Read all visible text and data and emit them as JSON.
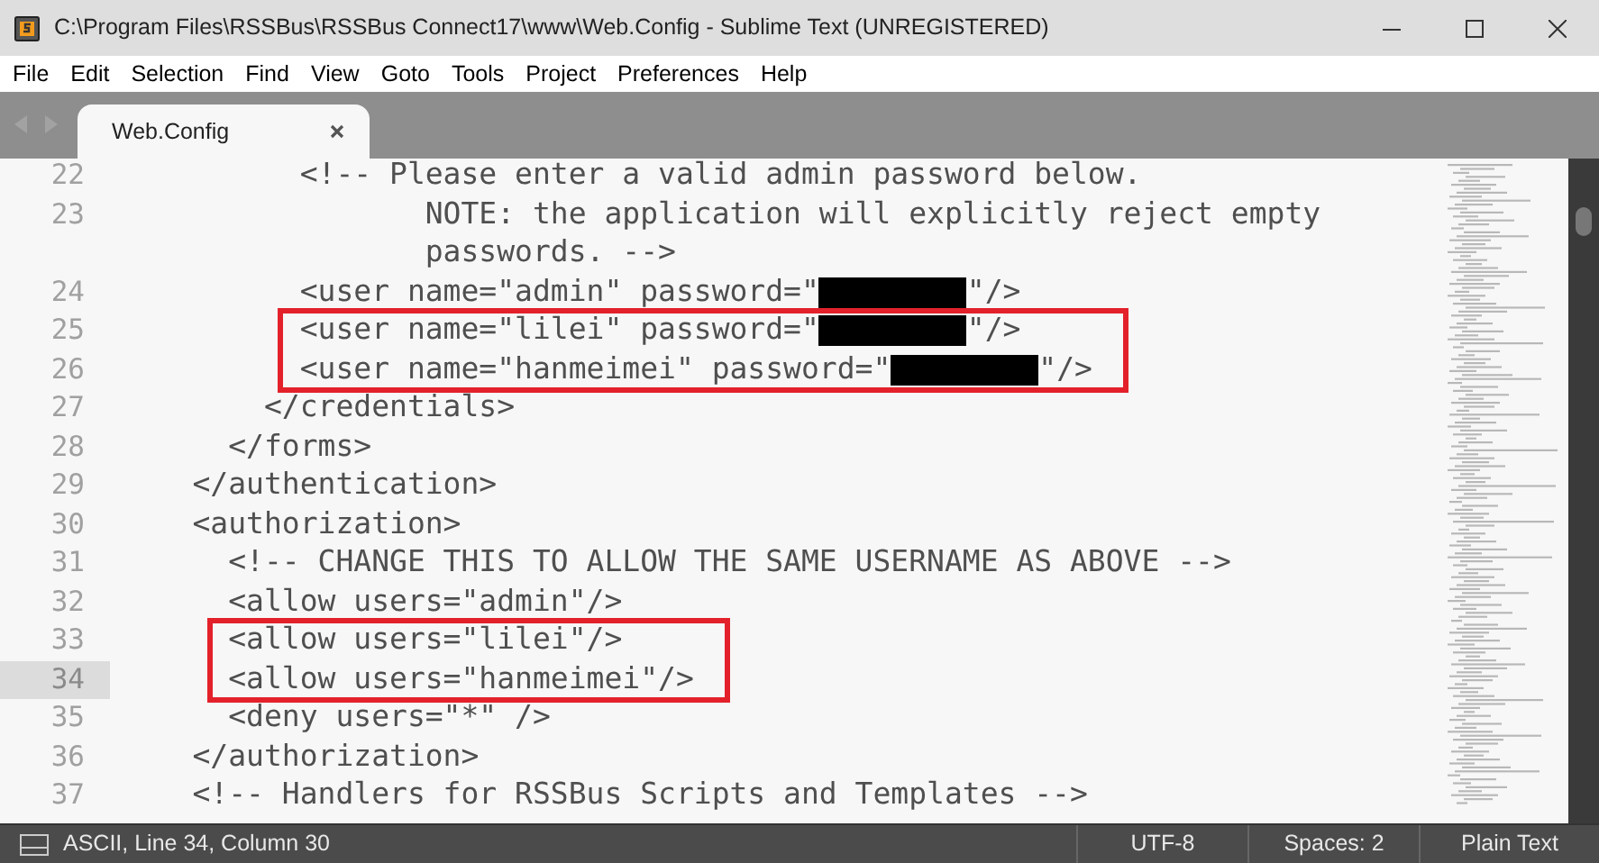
{
  "window": {
    "title": "C:\\Program Files\\RSSBus\\RSSBus Connect17\\www\\Web.Config - Sublime Text (UNREGISTERED)"
  },
  "menu": [
    "File",
    "Edit",
    "Selection",
    "Find",
    "View",
    "Goto",
    "Tools",
    "Project",
    "Preferences",
    "Help"
  ],
  "tabs": [
    {
      "label": "Web.Config",
      "selected": true
    }
  ],
  "lines": [
    {
      "number": "22",
      "current": false,
      "boxed": false,
      "rows": [
        [
          {
            "kind": "text",
            "text": "          <!-- Please enter a valid admin password below."
          }
        ]
      ]
    },
    {
      "number": "23",
      "current": false,
      "boxed": false,
      "rows": [
        [
          {
            "kind": "text",
            "text": "                 NOTE: the application will explicitly reject empty"
          }
        ],
        [
          {
            "kind": "text",
            "text": "                 passwords. -->"
          }
        ]
      ]
    },
    {
      "number": "24",
      "current": false,
      "boxed": false,
      "rows": [
        [
          {
            "kind": "text",
            "text": "          <user name=\"admin\" password=\""
          },
          {
            "kind": "redacted"
          },
          {
            "kind": "text",
            "text": "\"/>"
          }
        ]
      ]
    },
    {
      "number": "25",
      "current": false,
      "boxed": true,
      "rows": [
        [
          {
            "kind": "text",
            "text": "          <user name=\"lilei\" password=\""
          },
          {
            "kind": "redacted"
          },
          {
            "kind": "text",
            "text": "\"/>"
          }
        ]
      ]
    },
    {
      "number": "26",
      "current": false,
      "boxed": true,
      "rows": [
        [
          {
            "kind": "text",
            "text": "          <user name=\"hanmeimei\" password=\""
          },
          {
            "kind": "redacted"
          },
          {
            "kind": "text",
            "text": "\"/>"
          }
        ]
      ]
    },
    {
      "number": "27",
      "current": false,
      "boxed": false,
      "rows": [
        [
          {
            "kind": "text",
            "text": "        </credentials>"
          }
        ]
      ]
    },
    {
      "number": "28",
      "current": false,
      "boxed": false,
      "rows": [
        [
          {
            "kind": "text",
            "text": "      </forms>"
          }
        ]
      ]
    },
    {
      "number": "29",
      "current": false,
      "boxed": false,
      "rows": [
        [
          {
            "kind": "text",
            "text": "    </authentication>"
          }
        ]
      ]
    },
    {
      "number": "30",
      "current": false,
      "boxed": false,
      "rows": [
        [
          {
            "kind": "text",
            "text": "    <authorization>"
          }
        ]
      ]
    },
    {
      "number": "31",
      "current": false,
      "boxed": false,
      "rows": [
        [
          {
            "kind": "text",
            "text": "      <!-- CHANGE THIS TO ALLOW THE SAME USERNAME AS ABOVE -->"
          }
        ]
      ]
    },
    {
      "number": "32",
      "current": false,
      "boxed": false,
      "rows": [
        [
          {
            "kind": "text",
            "text": "      <allow users=\"admin\"/>"
          }
        ]
      ]
    },
    {
      "number": "33",
      "current": false,
      "boxed": true,
      "rows": [
        [
          {
            "kind": "text",
            "text": "      <allow users=\"lilei\"/>"
          }
        ]
      ]
    },
    {
      "number": "34",
      "current": true,
      "boxed": true,
      "rows": [
        [
          {
            "kind": "text",
            "text": "      <allow users=\"hanmeimei\"/>"
          }
        ]
      ]
    },
    {
      "number": "35",
      "current": false,
      "boxed": false,
      "rows": [
        [
          {
            "kind": "text",
            "text": "      <deny users=\"*\" />"
          }
        ]
      ]
    },
    {
      "number": "36",
      "current": false,
      "boxed": false,
      "rows": [
        [
          {
            "kind": "text",
            "text": "    </authorization>"
          }
        ]
      ]
    },
    {
      "number": "37",
      "current": false,
      "boxed": false,
      "rows": [
        [
          {
            "kind": "text",
            "text": "    <!-- Handlers for RSSBus Scripts and Templates -->"
          }
        ]
      ]
    }
  ],
  "status_bar": {
    "position": "ASCII, Line 34, Column 30",
    "encoding": "UTF-8",
    "indentation": "Spaces: 2",
    "syntax": "Plain Text"
  }
}
